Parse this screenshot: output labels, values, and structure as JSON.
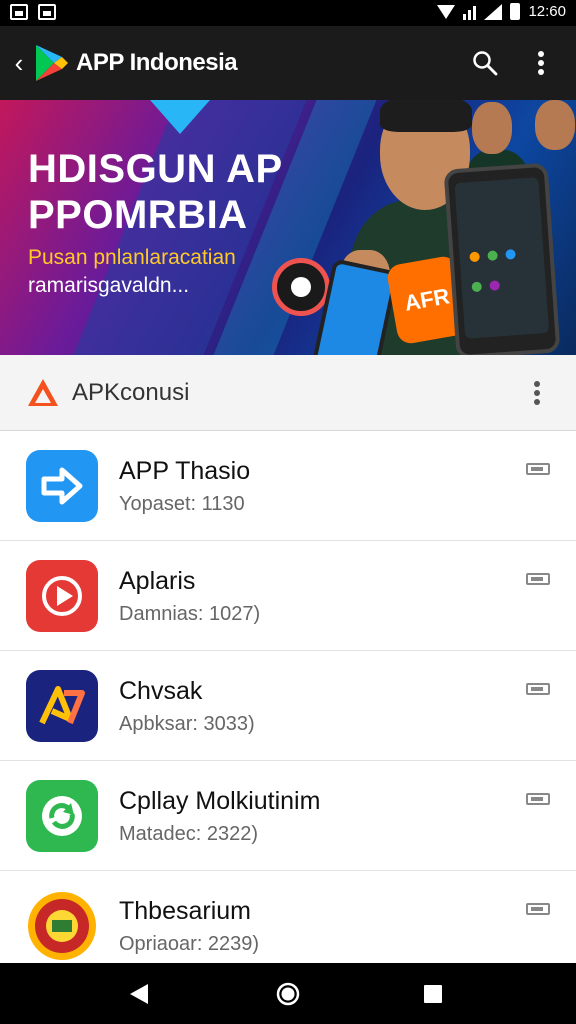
{
  "status_bar": {
    "time": "12:60"
  },
  "app_bar": {
    "title": "APP Indonesia"
  },
  "banner": {
    "headline_line1": "HDISGUN AP",
    "headline_line2": "PPOMRBIA",
    "subtitle_line1": "Pusan pnlanlaracatian",
    "subtitle_line2": "ramarisgavaldn...",
    "bag_text": "AFR"
  },
  "section": {
    "title": "APKconusi"
  },
  "apps": [
    {
      "name": "APP Thasio",
      "meta": "Yopaset: 1130",
      "icon": "arrow-right-icon",
      "color": "#2196f3"
    },
    {
      "name": "Aplaris",
      "meta": "Damnias: 1027)",
      "icon": "play-icon",
      "color": "#e53935"
    },
    {
      "name": "Chvsak",
      "meta": "Apbksar: 3033)",
      "icon": "a7-logo-icon",
      "color": "#1a237e"
    },
    {
      "name": "Cpllay Molkiutinim",
      "meta": "Matadec: 2322)",
      "icon": "refresh-icon",
      "color": "#2eb84f"
    },
    {
      "name": "Thbesarium",
      "meta": "Opriaoar: 2239)",
      "icon": "emblem-icon",
      "color": "#c62828"
    }
  ]
}
